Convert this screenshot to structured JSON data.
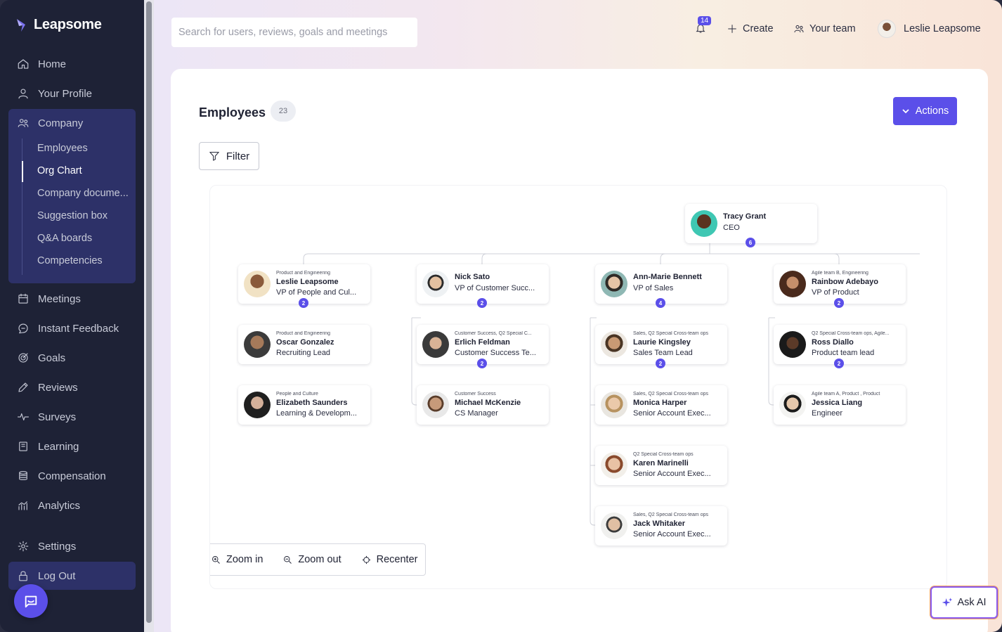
{
  "app": {
    "logo_text": "Leapsome"
  },
  "sidebar": {
    "home": "Home",
    "profile": "Your Profile",
    "company": "Company",
    "company_sub": [
      "Employees",
      "Org Chart",
      "Company docume...",
      "Suggestion box",
      "Q&A boards",
      "Competencies"
    ],
    "meetings": "Meetings",
    "feedback": "Instant Feedback",
    "goals": "Goals",
    "reviews": "Reviews",
    "surveys": "Surveys",
    "learning": "Learning",
    "compensation": "Compensation",
    "analytics": "Analytics",
    "settings": "Settings",
    "logout": "Log Out"
  },
  "topbar": {
    "search_placeholder": "Search for users, reviews, goals and meetings",
    "notifications": "14",
    "create": "Create",
    "your_team": "Your team",
    "user_name": "Leslie Leapsome"
  },
  "page": {
    "title": "Employees",
    "count": "23",
    "actions": "Actions",
    "filter": "Filter"
  },
  "org": {
    "ceo": {
      "name": "Tracy Grant",
      "role": "CEO",
      "count": "6"
    },
    "col1": [
      {
        "tag": "Product and Engineering",
        "name": "Leslie Leapsome",
        "role": "VP of People and Cul...",
        "count": "2"
      },
      {
        "tag": "Product and Engineering",
        "name": "Oscar Gonzalez",
        "role": "Recruiting Lead"
      },
      {
        "tag": "People and Culture",
        "name": "Elizabeth Saunders",
        "role": "Learning & Developm..."
      }
    ],
    "col2": [
      {
        "name": "Nick Sato",
        "role": "VP of Customer Succ...",
        "count": "2"
      },
      {
        "tag": "Customer Success, Q2 Special C...",
        "name": "Erlich Feldman",
        "role": "Customer Success Te...",
        "count": "2"
      },
      {
        "tag": "Customer Success",
        "name": "Michael McKenzie",
        "role": "CS Manager"
      }
    ],
    "col3": [
      {
        "name": "Ann-Marie Bennett",
        "role": "VP of Sales",
        "count": "4"
      },
      {
        "tag": "Sales, Q2 Special Cross-team ops",
        "name": "Laurie Kingsley",
        "role": "Sales Team Lead",
        "count": "2"
      },
      {
        "tag": "Sales, Q2 Special Cross-team ops",
        "name": "Monica Harper",
        "role": "Senior Account Exec..."
      },
      {
        "tag": "Q2 Special Cross-team ops",
        "name": "Karen Marinelli",
        "role": "Senior Account Exec..."
      },
      {
        "tag": "Sales, Q2 Special Cross-team ops",
        "name": "Jack Whitaker",
        "role": "Senior Account Exec..."
      }
    ],
    "col4": [
      {
        "tag": "Agile team B, Engineering",
        "name": "Rainbow Adebayo",
        "role": "VP of Product",
        "count": "2"
      },
      {
        "tag": "Q2 Special Cross-team ops, Agile...",
        "name": "Ross Diallo",
        "role": "Product team lead",
        "count": "2"
      },
      {
        "tag": "Agile team A, Product , Product",
        "name": "Jessica Liang",
        "role": "Engineer"
      }
    ]
  },
  "zoom": {
    "zoom_in": "Zoom in",
    "zoom_out": "Zoom out",
    "recenter": "Recenter"
  },
  "ask_ai": "Ask AI",
  "colors": {
    "accent": "#5b4fe9",
    "sidebar": "#1e2236",
    "sidebar_active": "#2d3168"
  }
}
